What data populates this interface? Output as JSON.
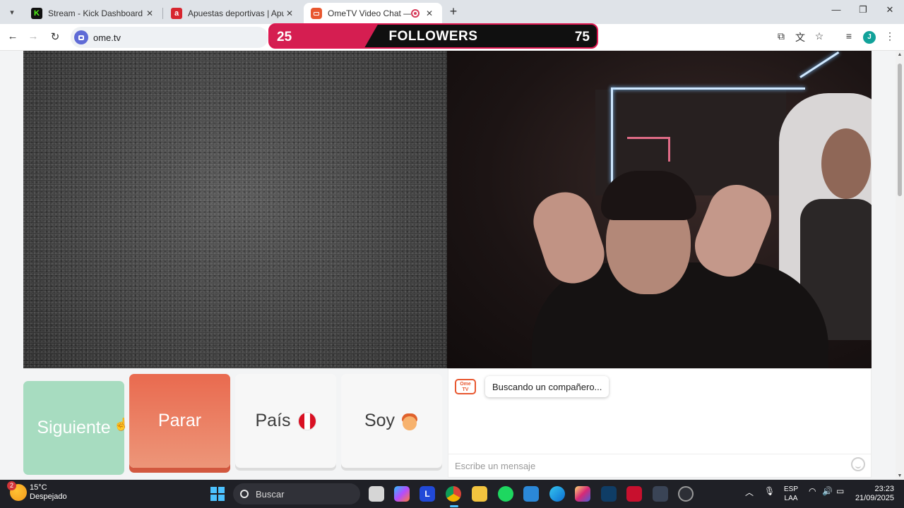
{
  "browser": {
    "tabs": [
      {
        "title": "Stream - Kick Dashboard",
        "favicon": "K",
        "color": "#53fc18"
      },
      {
        "title": "Apuestas deportivas | Apuestas",
        "favicon": "a",
        "color": "#d7262f"
      },
      {
        "title": "OmeTV Video Chat — Ome",
        "favicon": "",
        "color": "#e8572f",
        "active": true
      }
    ],
    "url": "ome.tv"
  },
  "goal": {
    "current": "25",
    "label": "FOLLOWERS",
    "target": "75",
    "progress_fraction": 0.33,
    "color": "#e01952"
  },
  "controls": {
    "next_label": "Siguiente",
    "stop_label": "Parar",
    "country_label": "País",
    "country_flag_icon": "peru-flag-icon",
    "iam_label": "Soy",
    "iam_icon": "boy-emoji-icon"
  },
  "chat": {
    "logo_text": "Ome TV",
    "status_message": "Buscando un compañero...",
    "input_placeholder": "Escribe un mensaje"
  },
  "taskbar": {
    "weather_temp": "15°C",
    "weather_desc": "Despejado",
    "weather_badge": "2",
    "search_placeholder": "Buscar",
    "lang_top": "ESP",
    "lang_bottom": "LAA",
    "time": "23:23",
    "date": "21/09/2025"
  }
}
